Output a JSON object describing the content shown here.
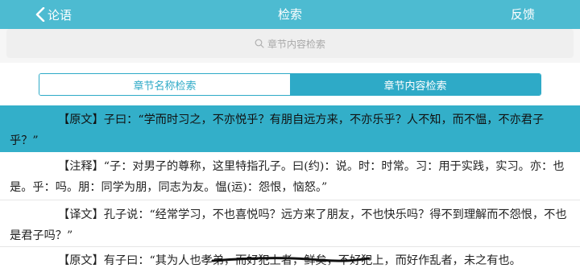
{
  "nav": {
    "back_label": "论语",
    "title": "检索",
    "right_label": "反馈"
  },
  "search": {
    "placeholder": "章节内容检索"
  },
  "tabs": [
    {
      "label": "章节名称检索",
      "active": false
    },
    {
      "label": "章节内容检索",
      "active": true
    }
  ],
  "rows": [
    "【原文】子曰：“学而时习之，不亦悦乎？有朋自远方来，不亦乐乎？人不知，而不愠，不亦君子乎？”",
    "【注释】“子：对男子的尊称，这里特指孔子。曰(约)：说。时：时常。习：用于实践，实习。亦：也是。乎：吗。朋：同学为朋，同志为友。愠(运)：怨恨，恼怒。”",
    "【译文】孔子说：“经常学习，不也喜悦吗？远方来了朋友，不也快乐吗？得不到理解而不怨恨，不也是君子吗？”",
    "【原文】有子曰：“其为人也孝弟，而好犯上者，鲜矣，不好犯上，而好作乱者，未之有也。"
  ],
  "colors": {
    "nav_bg": "#4dbbd1",
    "accent": "#2eaac7",
    "highlight_row": "#33afc9"
  }
}
